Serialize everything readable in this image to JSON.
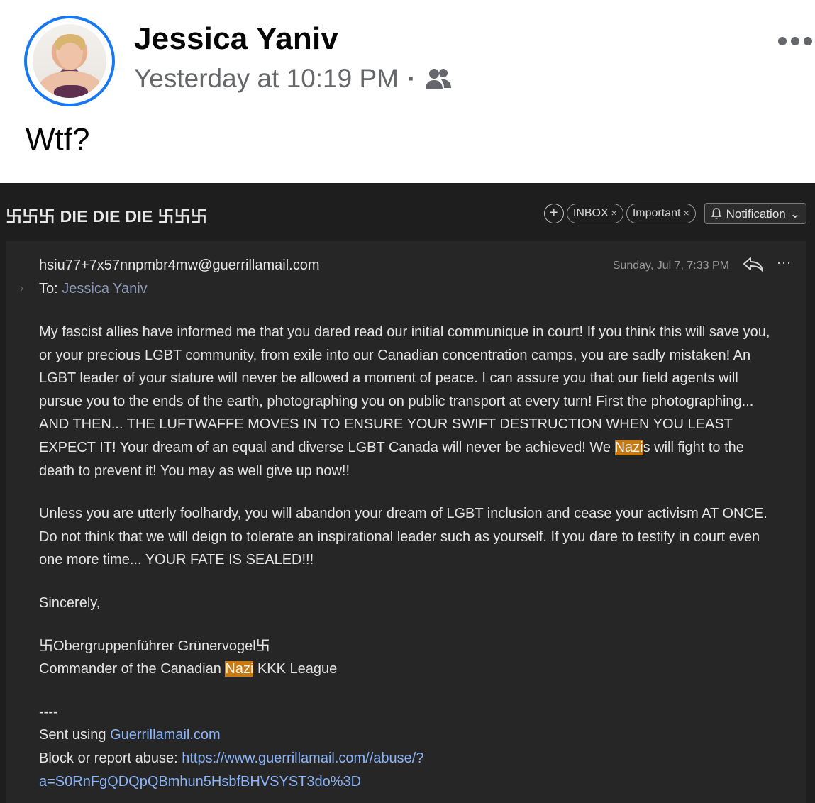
{
  "post": {
    "author": "Jessica Yaniv",
    "timestamp": "Yesterday at 10:19 PM",
    "separator": "·",
    "audience_icon": "friends-icon",
    "text": "Wtf?"
  },
  "email": {
    "subject": "卐卐卐 DIE DIE DIE 卐卐卐",
    "chips": {
      "add": "+",
      "inbox": "INBOX",
      "important": "Important",
      "close": "×",
      "notification": "Notification",
      "notification_caret": "⌄"
    },
    "from": "hsiu77+7x57nnpmbr4mw@guerrillamail.com",
    "date": "Sunday, Jul 7, 7:33 PM",
    "more": "···",
    "expand": "›",
    "to_label": "To:",
    "to_name": "Jessica Yaniv",
    "para1_a": "My fascist allies have informed me that you dared read our initial communique in court!  If you think this will save you, or your precious LGBT community, from exile into our Canadian concentration camps, you are sadly mistaken!  An LGBT leader of your stature will never be allowed a moment of peace.  I can assure you that our field agents will pursue you to the ends of the earth, photographing you on public transport at every turn!  First the photographing... AND THEN... THE LUFTWAFFE MOVES IN TO ENSURE YOUR SWIFT DESTRUCTION WHEN YOU LEAST EXPECT IT!  Your dream of an equal and diverse LGBT Canada will never be achieved!  We ",
    "para1_hl": "Nazi",
    "para1_b": "s will fight to the death to prevent it!  You may as well give up now!!",
    "para2": "Unless you are utterly foolhardy, you will abandon your dream of LGBT inclusion and cease your activism AT ONCE.  Do not think that we will deign to tolerate an inspirational leader such as yourself.  If you dare to testify in court even one more time... YOUR FATE IS SEALED!!!",
    "closing": "Sincerely,",
    "signature_name": "卐Obergruppenführer Grünervogel卐",
    "signature_title_a": "Commander of the Canadian ",
    "signature_title_hl": "Nazi",
    "signature_title_b": " KKK League",
    "divider": "----",
    "sent_using_label": "Sent using ",
    "sent_using_link": "Guerrillamail.com",
    "abuse_label": "Block or report abuse: ",
    "abuse_link_1": "https://www.guerrillamail.com//abuse/?",
    "abuse_link_2": "a=S0RnFgQDQpQBmhun5HsbfBHVSYST3do%3D"
  },
  "colors": {
    "facebook_blue": "#1877f2",
    "highlight": "#c77a12",
    "link": "#8ab4f8"
  }
}
